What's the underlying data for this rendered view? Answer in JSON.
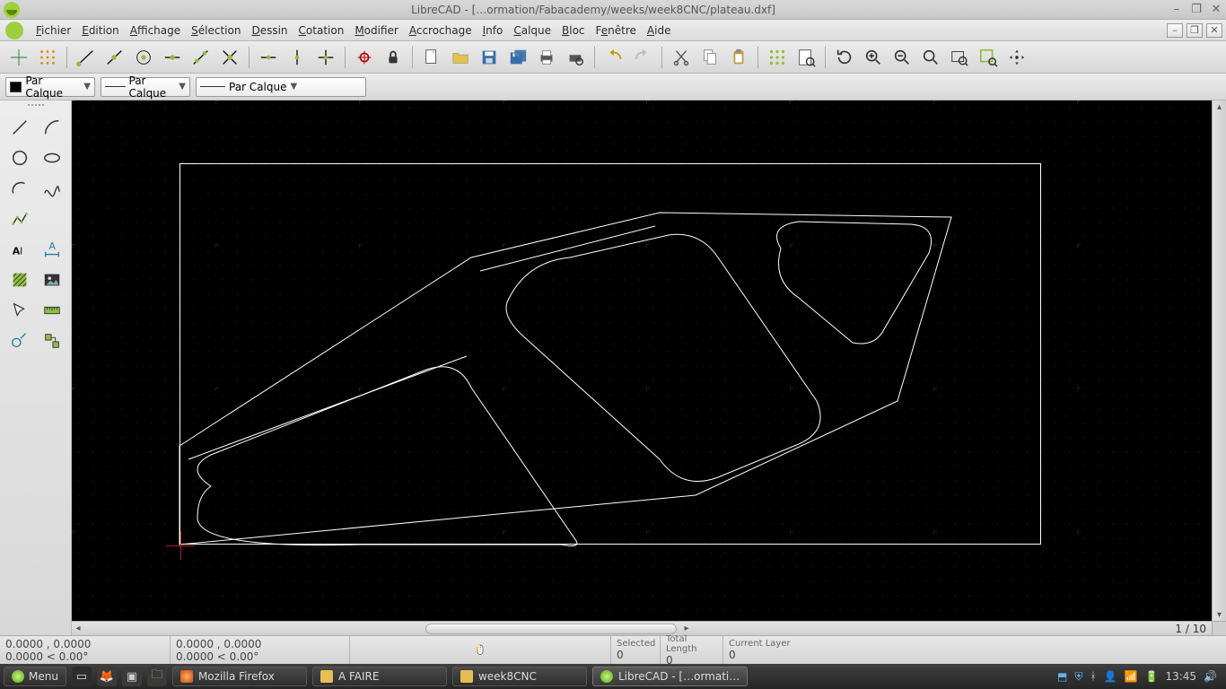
{
  "window": {
    "title": "LibreCAD - […ormation/Fabacademy/weeks/week8CNC/plateau.dxf]"
  },
  "menus": {
    "file": "Fichier",
    "edit": "Edition",
    "view": "Affichage",
    "select": "Sélection",
    "draw": "Dessin",
    "dimension": "Cotation",
    "modify": "Modifier",
    "snap": "Accrochage",
    "info": "Info",
    "layer": "Calque",
    "block": "Bloc",
    "window_menu": "Fenêtre",
    "help": "Aide"
  },
  "layer_props": {
    "color_combo": "Par Calque",
    "width_combo": "Par Calque",
    "linetype_combo": "Par Calque"
  },
  "status": {
    "abs_coord": "0.0000 , 0.0000",
    "abs_polar": "0.0000 < 0.00°",
    "rel_coord": "0.0000 , 0.0000",
    "rel_polar": "0.0000 < 0.00°",
    "selected_hdr": "Selected",
    "selected_val": "0",
    "length_hdr": "Total Length",
    "length_val": "0",
    "layer_hdr": "Current Layer",
    "layer_val": "0",
    "page_indicator": "1 / 10"
  },
  "taskbar": {
    "menu_label": "Menu",
    "task_firefox": "Mozilla Firefox",
    "task_afaire": "A FAIRE",
    "task_week8": "week8CNC",
    "task_librecad": "LibreCAD - […ormati…",
    "clock": "13:45"
  },
  "scrollbar": {
    "up": "▴",
    "down": "▾",
    "left": "◂",
    "right": "▸"
  },
  "mdi": {
    "min": "–",
    "max": "❐",
    "close": "✕"
  }
}
